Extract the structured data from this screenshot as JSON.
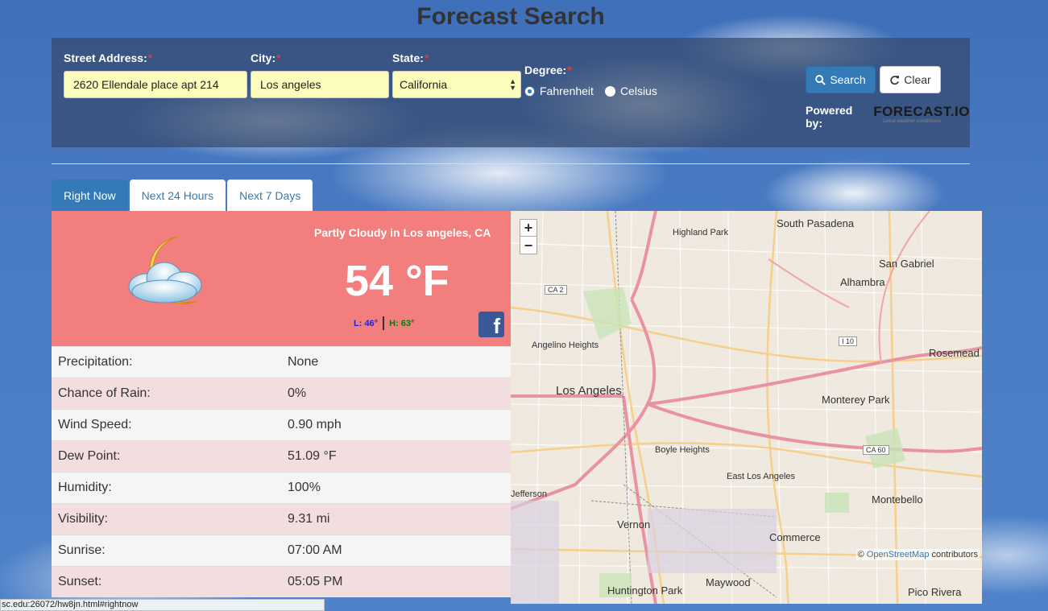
{
  "page": {
    "title": "Forecast Search"
  },
  "form": {
    "street_label": "Street Address:",
    "street_value": "2620 Ellendale place apt 214",
    "city_label": "City:",
    "city_value": "Los angeles",
    "state_label": "State:",
    "state_value": "California",
    "degree_label": "Degree:",
    "degree_options": [
      "Fahrenheit",
      "Celsius"
    ],
    "degree_selected": "Fahrenheit",
    "required_mark": "*",
    "search_label": "Search",
    "clear_label": "Clear",
    "powered_by": "Powered by:",
    "logo_text": "FORECAST.IO",
    "logo_subtext": "Local weather conditions"
  },
  "tabs": [
    {
      "label": "Right Now",
      "active": true
    },
    {
      "label": "Next 24 Hours",
      "active": false
    },
    {
      "label": "Next 7 Days",
      "active": false
    }
  ],
  "current": {
    "condition": "Partly Cloudy in Los angeles, CA",
    "temperature": "54 °F",
    "low": "L: 46°",
    "high": "H: 63°",
    "icon": "partly-cloudy-night-icon",
    "share_icon": "facebook-icon"
  },
  "details": [
    {
      "label": "Precipitation:",
      "value": "None"
    },
    {
      "label": "Chance of Rain:",
      "value": "0%"
    },
    {
      "label": "Wind Speed:",
      "value": "0.90 mph"
    },
    {
      "label": "Dew Point:",
      "value": "51.09 °F"
    },
    {
      "label": "Humidity:",
      "value": "100%"
    },
    {
      "label": "Visibility:",
      "value": "9.31 mi"
    },
    {
      "label": "Sunrise:",
      "value": "07:00 AM"
    },
    {
      "label": "Sunset:",
      "value": "05:05 PM"
    }
  ],
  "map": {
    "zoom_in": "+",
    "zoom_out": "−",
    "attribution_prefix": "©",
    "attribution_link": "OpenStreetMap",
    "attribution_suffix": "contributors",
    "places": [
      "South Pasadena",
      "Highland Park",
      "San Gabriel",
      "Alhambra",
      "Angelino Heights",
      "Los Angeles",
      "Rosemead",
      "Monterey Park",
      "Boyle Heights",
      "East Los Angeles",
      "Montebello",
      "Vernon",
      "Commerce",
      "Maywood",
      "Huntington Park",
      "Pico Rivera",
      "Jefferson"
    ],
    "shields": [
      "CA 2",
      "I 10",
      "CA 60"
    ]
  },
  "status_bar": {
    "url": "sc.edu:26072/hw8jn.html#rightnow"
  }
}
